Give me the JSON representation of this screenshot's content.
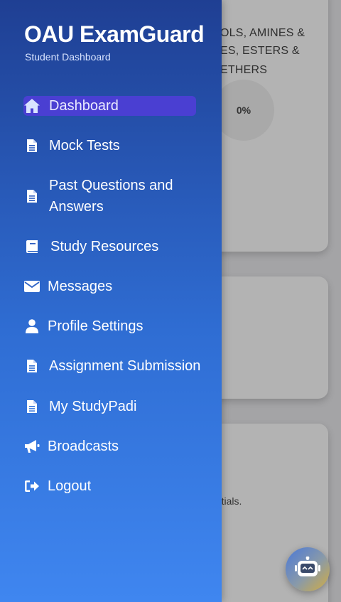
{
  "app": {
    "title": "OAU ExamGuard",
    "subtitle": "Student Dashboard"
  },
  "sidebar": {
    "items": [
      {
        "label": "Dashboard",
        "icon": "home-icon",
        "active": true
      },
      {
        "label": "Mock Tests",
        "icon": "file-icon"
      },
      {
        "label": "Past Questions and Answers",
        "icon": "file-icon"
      },
      {
        "label": "Study Resources",
        "icon": "book-icon"
      },
      {
        "label": "Messages",
        "icon": "envelope-icon"
      },
      {
        "label": "Profile Settings",
        "icon": "user-icon"
      },
      {
        "label": "Assignment Submission",
        "icon": "file-icon"
      },
      {
        "label": "My StudyPadi",
        "icon": "file-icon"
      },
      {
        "label": "Broadcasts",
        "icon": "megaphone-icon"
      },
      {
        "label": "Logout",
        "icon": "logout-icon"
      }
    ]
  },
  "background": {
    "card1": {
      "topic_lines": [
        "OLS, AMINES &",
        "ES, ESTERS &",
        "ETHERS"
      ],
      "progress_text": "0%"
    },
    "card3": {
      "note": "entials."
    }
  },
  "chatbot": {
    "icon": "robot-icon"
  },
  "colors": {
    "sidebar_top": "#1f3f93",
    "sidebar_bottom": "#3f86f0",
    "active_item": "#4a3fd2"
  }
}
